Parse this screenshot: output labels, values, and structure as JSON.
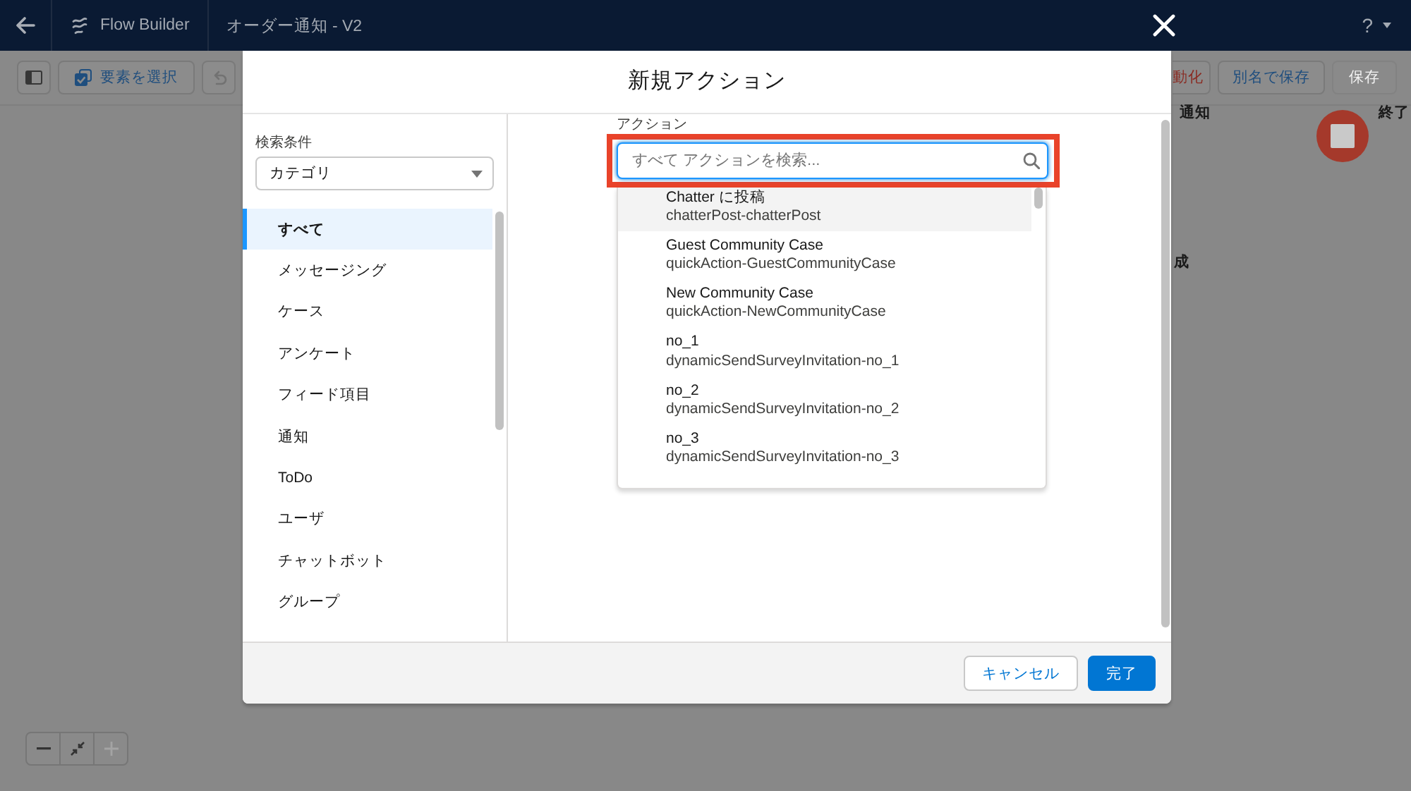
{
  "header": {
    "app_name": "Flow Builder",
    "flow_title": "オーダー通知 - V2",
    "help_label": "?"
  },
  "toolbar": {
    "select_button": "要素を選択",
    "undo": {
      "disabled": true
    },
    "right_buttons": [
      {
        "label": "動化",
        "kind": "destructive",
        "disabled": false
      },
      {
        "label": "別名で保存",
        "kind": "neutral",
        "disabled": false
      },
      {
        "label": "保存",
        "kind": "brand",
        "disabled": true
      }
    ]
  },
  "canvas": {
    "element_labels": [
      "通知",
      "成"
    ],
    "end_node": {
      "label": "終了"
    },
    "zoom_controls": [
      {
        "kind": "zoom-out",
        "disabled": false
      },
      {
        "kind": "fit",
        "disabled": false
      },
      {
        "kind": "zoom-in",
        "disabled": true
      }
    ]
  },
  "modal": {
    "title": "新規アクション",
    "filter": {
      "label": "検索条件",
      "value": "カテゴリ"
    },
    "categories": [
      {
        "label": "すべて",
        "selected": true
      },
      {
        "label": "メッセージング",
        "selected": false
      },
      {
        "label": "ケース",
        "selected": false
      },
      {
        "label": "アンケート",
        "selected": false
      },
      {
        "label": "フィード項目",
        "selected": false
      },
      {
        "label": "通知",
        "selected": false
      },
      {
        "label": "ToDo",
        "selected": false
      },
      {
        "label": "ユーザ",
        "selected": false
      },
      {
        "label": "チャットボット",
        "selected": false
      },
      {
        "label": "グループ",
        "selected": false
      }
    ],
    "action_search": {
      "label": "アクション",
      "placeholder": "すべて アクションを検索...",
      "focused": true,
      "highlighted": true
    },
    "actions": [
      {
        "name": "Chatter に投稿",
        "api_name": "chatterPost-chatterPost",
        "selected": true
      },
      {
        "name": "Guest Community Case",
        "api_name": "quickAction-GuestCommunityCase",
        "selected": false
      },
      {
        "name": "New Community Case",
        "api_name": "quickAction-NewCommunityCase",
        "selected": false
      },
      {
        "name": "no_1",
        "api_name": "dynamicSendSurveyInvitation-no_1",
        "selected": false
      },
      {
        "name": "no_2",
        "api_name": "dynamicSendSurveyInvitation-no_2",
        "selected": false
      },
      {
        "name": "no_3",
        "api_name": "dynamicSendSurveyInvitation-no_3",
        "selected": false
      }
    ],
    "buttons": [
      {
        "label": "キャンセル",
        "kind": "neutral"
      },
      {
        "label": "完了",
        "kind": "brand"
      }
    ]
  }
}
